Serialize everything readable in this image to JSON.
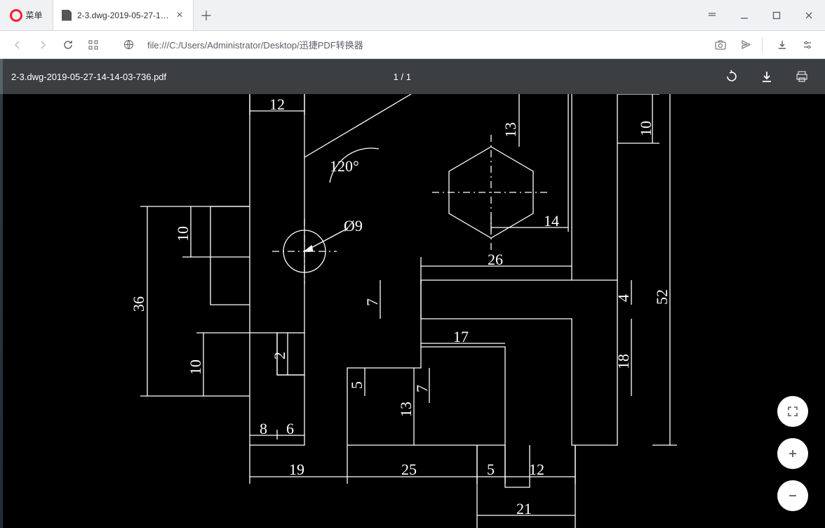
{
  "app": {
    "menu_label": "菜单"
  },
  "tabs": {
    "active": {
      "title": "2-3.dwg-2019-05-27-14…"
    }
  },
  "address": {
    "scheme_label": "file:///",
    "url_text": "file:///C:/Users/Administrator/Desktop/迅捷PDF转换器"
  },
  "viewer": {
    "filename": "2-3.dwg-2019-05-27-14-14-03-736.pdf",
    "page_indicator": "1 / 1"
  },
  "drawing": {
    "angle_label": "120°",
    "diameter_label": "Ø9",
    "dims": {
      "d12": "12",
      "d13": "13",
      "d10_top_right": "10",
      "d14": "14",
      "d26": "26",
      "d10_left_upper": "10",
      "d36": "36",
      "d10_left_lower": "10",
      "d2": "2",
      "d7_mid": "7",
      "d4": "4",
      "d52": "52",
      "d17": "17",
      "d18": "18",
      "d5_up": "5",
      "d7_low": "7",
      "d13_low": "13",
      "d8": "8",
      "d6": "6",
      "d19": "19",
      "d25": "25",
      "d5_bottom": "5",
      "d12_bottom": "12",
      "d21": "21"
    }
  }
}
